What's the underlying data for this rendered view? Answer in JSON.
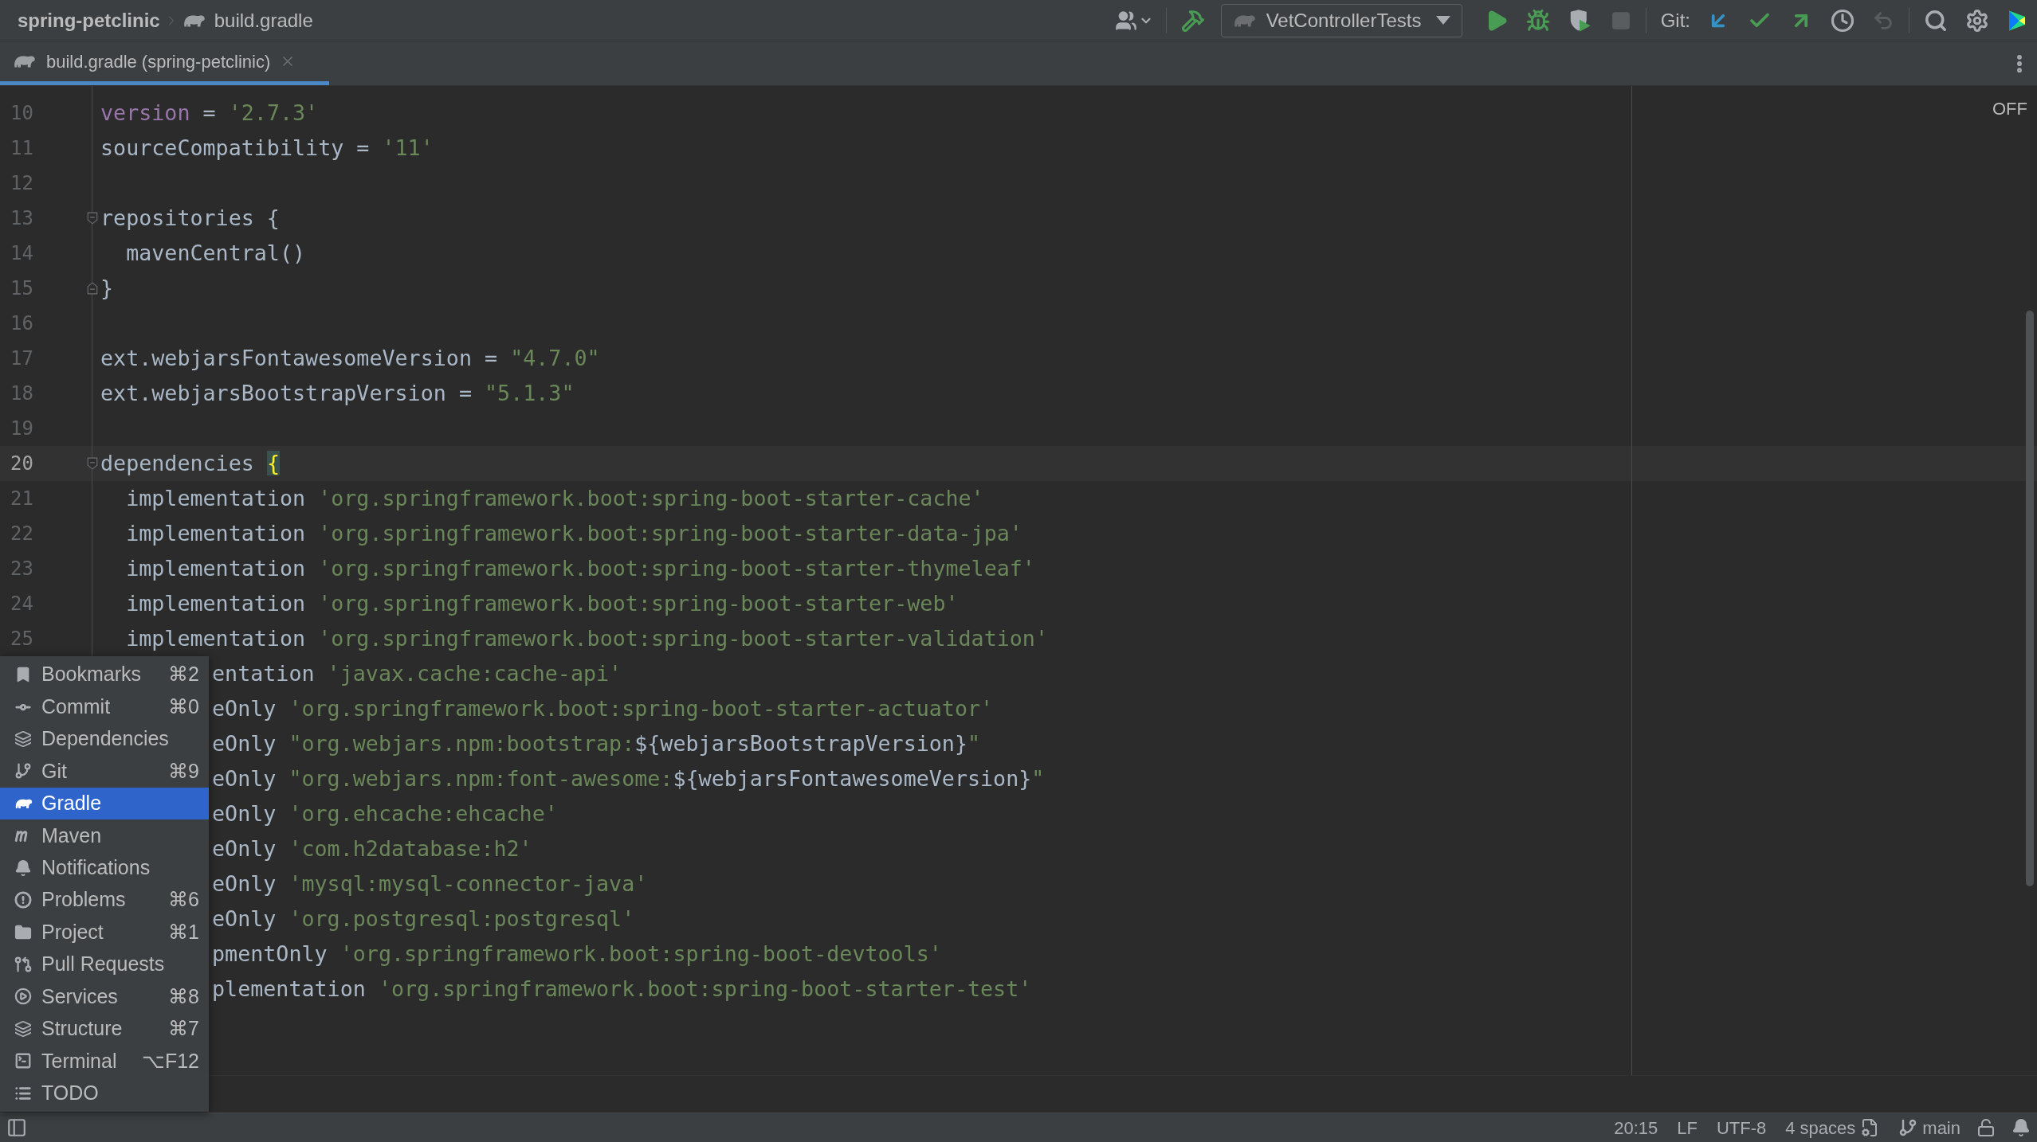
{
  "breadcrumb": {
    "project": "spring-petclinic",
    "file": "build.gradle"
  },
  "toolbar": {
    "run_configuration": "VetControllerTests",
    "git_label": "Git:",
    "stop": {
      "disabled": true
    },
    "rollback": {
      "disabled": true
    }
  },
  "tabs": [
    {
      "label": "build.gradle (spring-petclinic)",
      "selected": true
    }
  ],
  "editor": {
    "inspection_widget": "OFF",
    "lines": [
      {
        "number": "10",
        "kind": "full",
        "current": false,
        "tokens": [
          {
            "kind": "keyword",
            "text": "version"
          },
          {
            "kind": "plain",
            "text": " = "
          },
          {
            "kind": "string",
            "text": "'2.7.3'"
          }
        ]
      },
      {
        "number": "11",
        "kind": "full",
        "current": false,
        "tokens": [
          {
            "kind": "plain",
            "text": "sourceCompatibility = "
          },
          {
            "kind": "string",
            "text": "'11'"
          }
        ]
      },
      {
        "number": "12",
        "kind": "full",
        "current": false
      },
      {
        "number": "13",
        "kind": "full",
        "current": false,
        "fold": {
          "kind": "start"
        },
        "tokens": [
          {
            "kind": "plain",
            "text": "repositories {"
          }
        ]
      },
      {
        "number": "14",
        "kind": "full",
        "current": false,
        "tokens": [
          {
            "kind": "plain",
            "text": "  mavenCentral()"
          }
        ]
      },
      {
        "number": "15",
        "kind": "full",
        "current": false,
        "fold": {
          "kind": "end"
        },
        "tokens": [
          {
            "kind": "plain",
            "text": "}"
          }
        ]
      },
      {
        "number": "16",
        "kind": "full",
        "current": false
      },
      {
        "number": "17",
        "kind": "full",
        "current": false,
        "tokens": [
          {
            "kind": "plain",
            "text": "ext.webjarsFontawesomeVersion = "
          },
          {
            "kind": "string",
            "text": "\"4.7.0\""
          }
        ]
      },
      {
        "number": "18",
        "kind": "full",
        "current": false,
        "tokens": [
          {
            "kind": "plain",
            "text": "ext.webjarsBootstrapVersion = "
          },
          {
            "kind": "string",
            "text": "\"5.1.3\""
          }
        ]
      },
      {
        "number": "19",
        "kind": "full",
        "current": false
      },
      {
        "number": "20",
        "kind": "full",
        "current": true,
        "fold": {
          "kind": "start"
        },
        "tokens": [
          {
            "kind": "plain",
            "text": "dependencies "
          },
          {
            "kind": "brace",
            "text": "{"
          }
        ]
      },
      {
        "number": "21",
        "kind": "full",
        "current": false,
        "tokens": [
          {
            "kind": "plain",
            "text": "  implementation "
          },
          {
            "kind": "string",
            "text": "'org.springframework.boot:spring-boot-starter-cache'"
          }
        ]
      },
      {
        "number": "22",
        "kind": "full",
        "current": false,
        "tokens": [
          {
            "kind": "plain",
            "text": "  implementation "
          },
          {
            "kind": "string",
            "text": "'org.springframework.boot:spring-boot-starter-data-jpa'"
          }
        ]
      },
      {
        "number": "23",
        "kind": "full",
        "current": false,
        "tokens": [
          {
            "kind": "plain",
            "text": "  implementation "
          },
          {
            "kind": "string",
            "text": "'org.springframework.boot:spring-boot-starter-thymeleaf'"
          }
        ]
      },
      {
        "number": "24",
        "kind": "full",
        "current": false,
        "tokens": [
          {
            "kind": "plain",
            "text": "  implementation "
          },
          {
            "kind": "string",
            "text": "'org.springframework.boot:spring-boot-starter-web'"
          }
        ]
      },
      {
        "number": "25",
        "kind": "full",
        "current": false,
        "tokens": [
          {
            "kind": "plain",
            "text": "  implementation "
          },
          {
            "kind": "string",
            "text": "'org.springframework.boot:spring-boot-starter-validation'"
          }
        ]
      },
      {
        "kind": "covered",
        "current": false,
        "tokens": [
          {
            "kind": "plain",
            "text": "entation "
          },
          {
            "kind": "string",
            "text": "'javax.cache:cache-api'"
          }
        ]
      },
      {
        "kind": "covered",
        "current": false,
        "tokens": [
          {
            "kind": "plain",
            "text": "eOnly "
          },
          {
            "kind": "string",
            "text": "'org.springframework.boot:spring-boot-starter-actuator'"
          }
        ]
      },
      {
        "kind": "covered",
        "current": false,
        "tokens": [
          {
            "kind": "plain",
            "text": "eOnly "
          },
          {
            "kind": "string",
            "text": "\"org.webjars.npm:bootstrap:"
          },
          {
            "kind": "plain",
            "text": "${webjarsBootstrapVersion}"
          },
          {
            "kind": "string",
            "text": "\""
          }
        ]
      },
      {
        "kind": "covered",
        "current": false,
        "tokens": [
          {
            "kind": "plain",
            "text": "eOnly "
          },
          {
            "kind": "string",
            "text": "\"org.webjars.npm:font-awesome:"
          },
          {
            "kind": "plain",
            "text": "${webjarsFontawesomeVersion}"
          },
          {
            "kind": "string",
            "text": "\""
          }
        ]
      },
      {
        "kind": "covered",
        "current": false,
        "tokens": [
          {
            "kind": "plain",
            "text": "eOnly "
          },
          {
            "kind": "string",
            "text": "'org.ehcache:ehcache'"
          }
        ]
      },
      {
        "kind": "covered",
        "current": false,
        "tokens": [
          {
            "kind": "plain",
            "text": "eOnly "
          },
          {
            "kind": "string",
            "text": "'com.h2database:h2'"
          }
        ]
      },
      {
        "kind": "covered",
        "current": false,
        "tokens": [
          {
            "kind": "plain",
            "text": "eOnly "
          },
          {
            "kind": "string",
            "text": "'mysql:mysql-connector-java'"
          }
        ]
      },
      {
        "kind": "covered",
        "current": false,
        "tokens": [
          {
            "kind": "plain",
            "text": "eOnly "
          },
          {
            "kind": "string",
            "text": "'org.postgresql:postgresql'"
          }
        ]
      },
      {
        "kind": "covered",
        "current": false,
        "tokens": [
          {
            "kind": "plain",
            "text": "pmentOnly "
          },
          {
            "kind": "string",
            "text": "'org.springframework.boot:spring-boot-devtools'"
          }
        ]
      },
      {
        "kind": "covered",
        "current": false,
        "tokens": [
          {
            "kind": "plain",
            "text": "plementation "
          },
          {
            "kind": "string",
            "text": "'org.springframework.boot:spring-boot-starter-test'"
          }
        ]
      }
    ]
  },
  "tool_window_menu": {
    "items": [
      {
        "label": "Bookmarks",
        "shortcut": "⌘2",
        "selected": false
      },
      {
        "label": "Commit",
        "shortcut": "⌘0",
        "selected": false
      },
      {
        "label": "Dependencies",
        "selected": false
      },
      {
        "label": "Git",
        "shortcut": "⌘9",
        "selected": false
      },
      {
        "label": "Gradle",
        "selected": true
      },
      {
        "label": "Maven",
        "selected": false
      },
      {
        "label": "Notifications",
        "selected": false
      },
      {
        "label": "Problems",
        "shortcut": "⌘6",
        "selected": false
      },
      {
        "label": "Project",
        "shortcut": "⌘1",
        "selected": false
      },
      {
        "label": "Pull Requests",
        "selected": false
      },
      {
        "label": "Services",
        "shortcut": "⌘8",
        "selected": false
      },
      {
        "label": "Structure",
        "shortcut": "⌘7",
        "selected": false
      },
      {
        "label": "Terminal",
        "shortcut": "⌥F12",
        "selected": false
      },
      {
        "label": "TODO",
        "selected": false
      }
    ]
  },
  "status_bar": {
    "position": "20:15",
    "line_separator": "LF",
    "encoding": "UTF-8",
    "indent": "4 spaces",
    "branch": "main"
  }
}
